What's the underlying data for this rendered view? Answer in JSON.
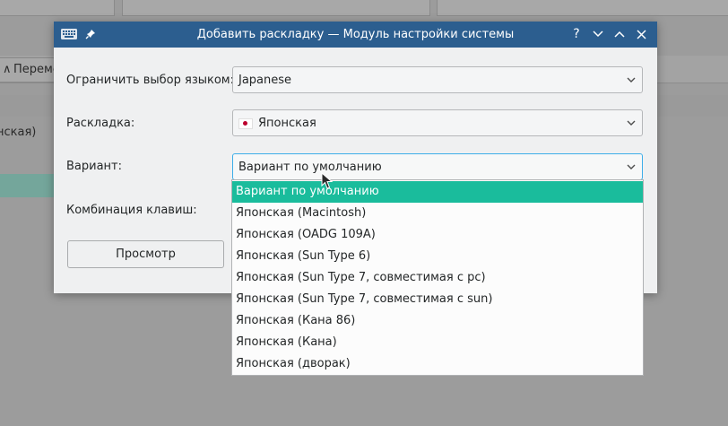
{
  "background_app": {
    "toolbar_button_label": "Переме",
    "toolbar_button_arrow": "∧",
    "row_text": "нская)"
  },
  "dialog": {
    "title": "Добавить раскладку — Модуль настройки системы",
    "titlebar_buttons": {
      "help": "?",
      "minimize": "∨",
      "maximize": "∧",
      "close": "✕"
    },
    "fields": {
      "language": {
        "label": "Ограничить выбор языком:",
        "value": "Japanese"
      },
      "layout": {
        "label": "Раскладка:",
        "value": "Японская"
      },
      "variant": {
        "label": "Вариант:",
        "value": "Вариант по умолчанию"
      },
      "shortcut": {
        "label": "Комбинация клавиш:"
      }
    },
    "preview_button": "Просмотр"
  },
  "variant_dropdown": {
    "options": [
      "Вариант по умолчанию",
      "Японская (Macintosh)",
      "Японская (OADG 109A)",
      "Японская (Sun Type 6)",
      "Японская (Sun Type 7, совместимая с pc)",
      "Японская (Sun Type 7, совместимая с sun)",
      "Японская (Кана 86)",
      "Японская (Кана)",
      "Японская (дворак)"
    ],
    "selected_index": 0
  },
  "colors": {
    "titlebar": "#2c5e8f",
    "selection": "#1abc9c",
    "focus_border": "#3daee9"
  }
}
